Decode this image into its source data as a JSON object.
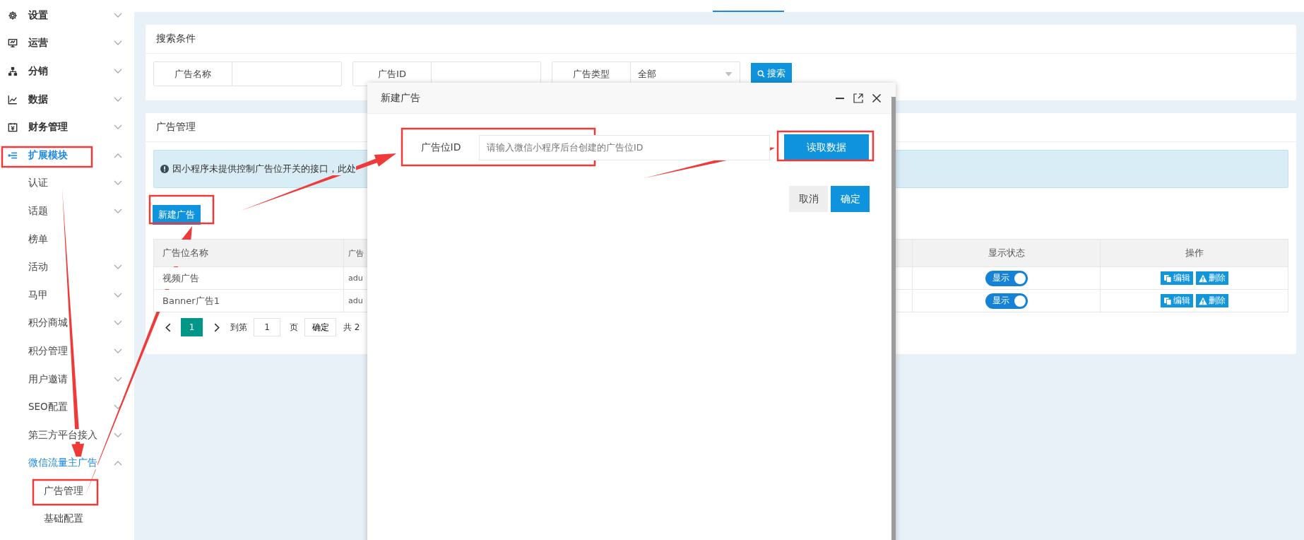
{
  "sidebar": {
    "items": [
      {
        "label": "设置",
        "kind": "group",
        "expanded": false
      },
      {
        "label": "运营",
        "kind": "group",
        "expanded": false
      },
      {
        "label": "分销",
        "kind": "group",
        "expanded": false
      },
      {
        "label": "数据",
        "kind": "group",
        "expanded": false
      },
      {
        "label": "财务管理",
        "kind": "group",
        "expanded": false
      },
      {
        "label": "扩展模块",
        "kind": "group",
        "expanded": true,
        "children": [
          {
            "label": "认证",
            "kind": "group",
            "expanded": false
          },
          {
            "label": "话题",
            "kind": "group",
            "expanded": false
          },
          {
            "label": "榜单",
            "kind": "link"
          },
          {
            "label": "活动",
            "kind": "group",
            "expanded": false
          },
          {
            "label": "马甲",
            "kind": "group",
            "expanded": false
          },
          {
            "label": "积分商城",
            "kind": "group",
            "expanded": false
          },
          {
            "label": "积分管理",
            "kind": "group",
            "expanded": false
          },
          {
            "label": "用户邀请",
            "kind": "group",
            "expanded": false
          },
          {
            "label": "SEO配置",
            "kind": "group",
            "expanded": false
          },
          {
            "label": "第三方平台接入",
            "kind": "group",
            "expanded": false
          },
          {
            "label": "微信流量主广告",
            "kind": "group",
            "expanded": true,
            "children": [
              {
                "label": "广告管理",
                "kind": "link"
              },
              {
                "label": "基础配置",
                "kind": "link"
              }
            ]
          }
        ]
      }
    ]
  },
  "search": {
    "title": "搜索条件",
    "fields": [
      {
        "kind": "text",
        "label": "广告名称"
      },
      {
        "kind": "text",
        "label": "广告ID"
      },
      {
        "kind": "select",
        "label": "广告类型",
        "value": "全部"
      }
    ],
    "button": "搜索"
  },
  "ads": {
    "title": "广告管理",
    "notice": "因小程序未提供控制广告位开关的接口，此处",
    "new_button": "新建广告",
    "table": {
      "columns": [
        "广告位名称",
        "广告",
        "显示状态",
        "操作"
      ],
      "rows": [
        {
          "name": "视频广告",
          "column_2": "adu",
          "status": {
            "label": "显示",
            "on": true
          },
          "actions": [
            "编辑",
            "删除"
          ]
        },
        {
          "name": "Banner广告1",
          "column_2": "adu",
          "status": {
            "label": "显示",
            "on": true
          },
          "actions": [
            "编辑",
            "删除"
          ]
        }
      ]
    },
    "pagination": {
      "pages": [
        {
          "label": "1",
          "selected": true
        }
      ],
      "goto_label": "到第",
      "goto_value": "1",
      "page_unit": "页",
      "confirm": "确定",
      "total": "共 2"
    }
  },
  "dialog": {
    "title": "新建广告",
    "field": {
      "label": "广告位ID",
      "placeholder": "请输入微信小程序后台创建的广告位ID"
    },
    "read_button": "读取数据",
    "buttons": [
      {
        "label": "取消",
        "kind": "secondary"
      },
      {
        "label": "确定",
        "kind": "primary"
      }
    ]
  }
}
